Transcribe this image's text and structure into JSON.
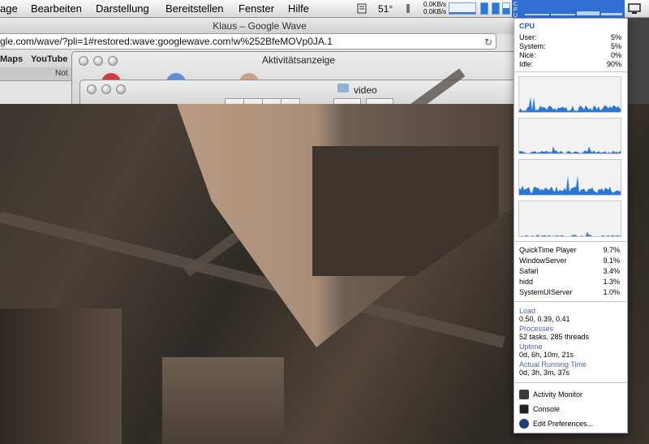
{
  "menubar": {
    "items": [
      "age",
      "Bearbeiten",
      "Darstellung",
      "Bereitstellen",
      "Fenster",
      "Hilfe"
    ],
    "temperature": "51°",
    "net_up": "0.0KB/s",
    "net_down": "0.0KB/s"
  },
  "browser": {
    "title": "Klaus – Google Wave",
    "url": "gle.com/wave/?pli=1#restored:wave:googlewave.com!w%252BfeMOVp0JA.1",
    "bookmarks": [
      "Maps",
      "YouTube"
    ],
    "tab_label": "Not"
  },
  "activity_window": {
    "title": "Aktivitätsanzeige"
  },
  "video_window": {
    "title": "video"
  },
  "cpu_menu": {
    "heading": "CPU",
    "stats": [
      {
        "label": "User:",
        "value": "5%"
      },
      {
        "label": "System:",
        "value": "5%"
      },
      {
        "label": "Nice:",
        "value": "0%"
      },
      {
        "label": "Idle:",
        "value": "90%"
      }
    ],
    "processes": [
      {
        "name": "QuickTime Player",
        "value": "9.7%"
      },
      {
        "name": "WindowServer",
        "value": "9.1%"
      },
      {
        "name": "Safari",
        "value": "3.4%"
      },
      {
        "name": "hidd",
        "value": "1.3%"
      },
      {
        "name": "SystemUIServer",
        "value": "1.0%"
      }
    ],
    "load_label": "Load",
    "load_value": "0.50, 0.39, 0.41",
    "processes_label": "Processes",
    "processes_value": "52 tasks, 285 threads",
    "uptime_label": "Uptime",
    "uptime_value": "0d, 6h, 10m, 21s",
    "running_label": "Actual Running Time",
    "running_value": "0d, 3h, 3m, 37s",
    "actions": [
      "Activity Monitor",
      "Console",
      "Edit Preferences..."
    ]
  },
  "colors": {
    "accent": "#1b58c4",
    "graph_fill": "#2a78d6",
    "menubar_highlight": "#2f6fd1"
  }
}
